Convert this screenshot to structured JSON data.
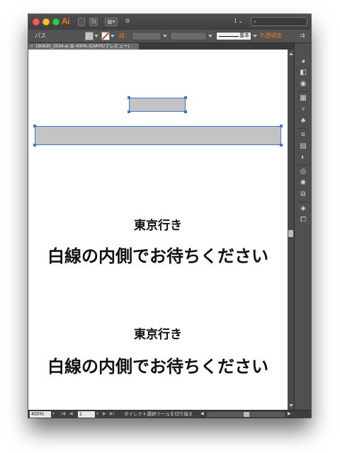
{
  "app": {
    "logo": "Ai",
    "page_indicator": "1 ⌄",
    "search_icon": "search-icon"
  },
  "control_bar": {
    "selection_type": "パス",
    "stroke_label": "線：",
    "stroke_style": "基本",
    "opacity_label": "不透明度",
    "accent_color": "#e07a2a"
  },
  "document": {
    "tab_title": "160630_2034.ai @ 400% (CMYK/プレビュー)"
  },
  "canvas": {
    "sign_1": {
      "destination": "東京行き",
      "warning": "白線の内側でお待ちください"
    },
    "sign_2": {
      "destination": "東京行き",
      "warning": "白線の内側でお待ちください"
    },
    "selection_color": "#3f74d9",
    "object_fill": "#c3c3c3"
  },
  "status_bar": {
    "zoom": "400%",
    "page": "1",
    "tool_status": "ダイレクト選択ツールを切り換え"
  }
}
